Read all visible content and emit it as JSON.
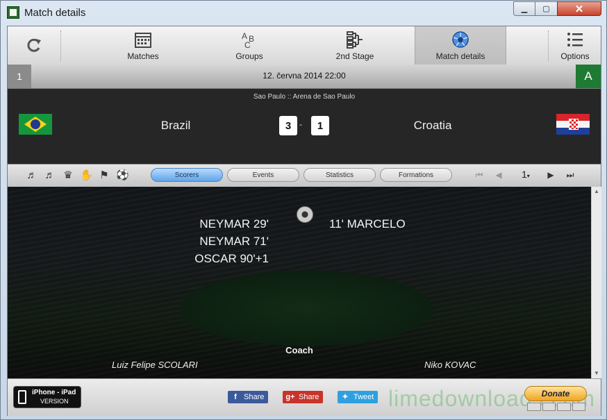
{
  "window": {
    "title": "Match details"
  },
  "toolbar": {
    "matches_label": "Matches",
    "groups_label": "Groups",
    "stage_label": "2nd Stage",
    "match_details_label": "Match details",
    "options_label": "Options"
  },
  "match": {
    "number": "1",
    "date": "12. června 2014 22:00",
    "group": "A",
    "venue": "Sao Paulo  ::  Arena de Sao Paulo",
    "home_team": "Brazil",
    "away_team": "Croatia",
    "home_score": "3",
    "away_score": "1",
    "score_separator": "-"
  },
  "tabs": {
    "scorers": "Scorers",
    "events": "Events",
    "statistics": "Statistics",
    "formations": "Formations"
  },
  "pager": {
    "page": "1",
    "caret": "▾"
  },
  "scorers": {
    "home": [
      "NEYMAR 29'",
      "NEYMAR 71'",
      "OSCAR 90'+1"
    ],
    "away": [
      "11' MARCELO"
    ]
  },
  "coaches": {
    "label": "Coach",
    "home": "Luiz Felipe SCOLARI",
    "away": "Niko KOVAC"
  },
  "footer": {
    "iphone_title": "iPhone - iPad",
    "iphone_sub": "VERSION",
    "share_fb": "Share",
    "share_gp": "Share",
    "share_tw": "Tweet",
    "donate": "Donate",
    "watermark": "limedownloads.com"
  }
}
